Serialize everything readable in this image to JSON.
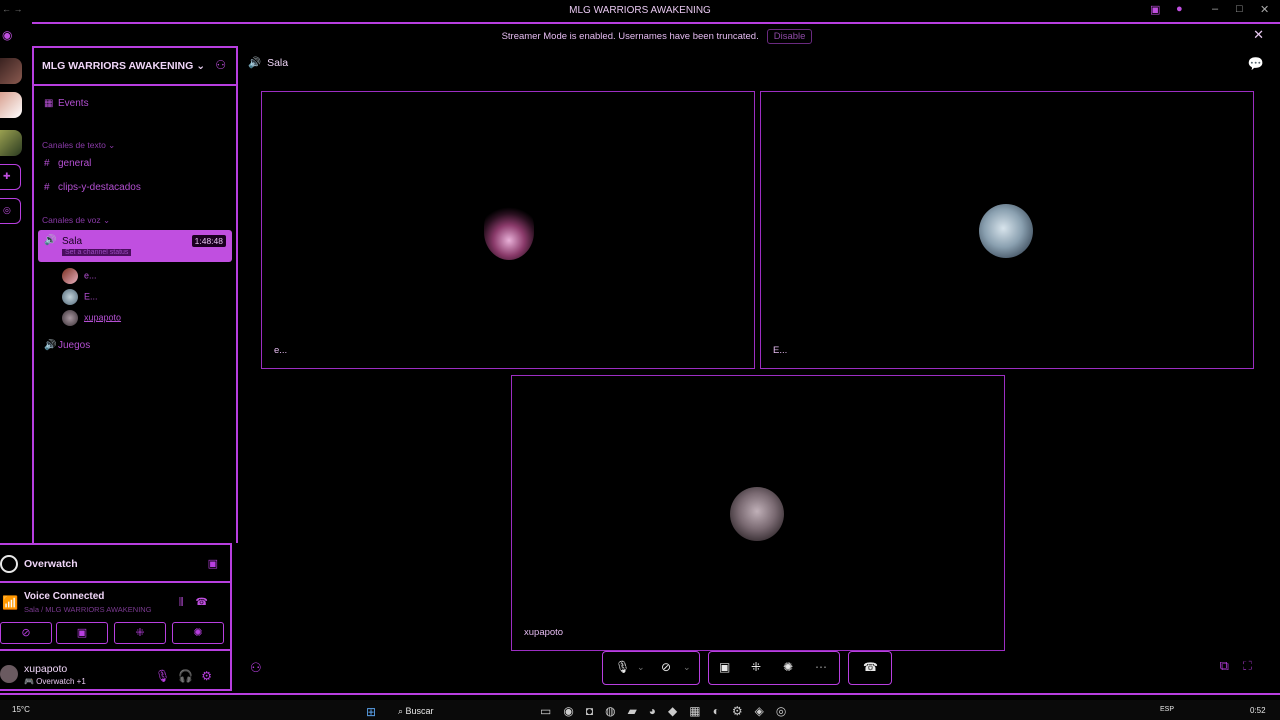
{
  "window": {
    "title": "MLG WARRIORS AWAKENING",
    "nav": "←  →"
  },
  "banner": {
    "message": "Streamer Mode is enabled. Usernames have been truncated.",
    "disable_label": "Disable"
  },
  "sidebar": {
    "guild_name": "MLG WARRIORS AWAKENING",
    "events_label": "Events",
    "text_category": "Canales de texto",
    "text_channels": [
      "general",
      "clips-y-destacados"
    ],
    "voice_category": "Canales de voz",
    "active_voice": {
      "name": "Sala",
      "timer": "1:48:48",
      "status": "Set a channel status"
    },
    "members": [
      "e...",
      "E...",
      "xupapoto"
    ],
    "other_voice": "Juegos"
  },
  "panel": {
    "game": "Overwatch",
    "voice_title": "Voice Connected",
    "voice_sub": "Sala / MLG WARRIORS AWAKENING",
    "username": "xupapoto",
    "user_status": "🎮 Overwatch +1"
  },
  "main": {
    "channel": "Sala",
    "tiles": [
      {
        "label": "e..."
      },
      {
        "label": "E..."
      },
      {
        "label": "xupapoto"
      }
    ]
  },
  "taskbar": {
    "temp": "15°C",
    "search_placeholder": "Buscar",
    "lang": "ESP",
    "time": "0:52"
  },
  "colors": {
    "accent": "#b83fe0",
    "voice_active": "#c04fe0",
    "connected": "#2fbf5c"
  }
}
